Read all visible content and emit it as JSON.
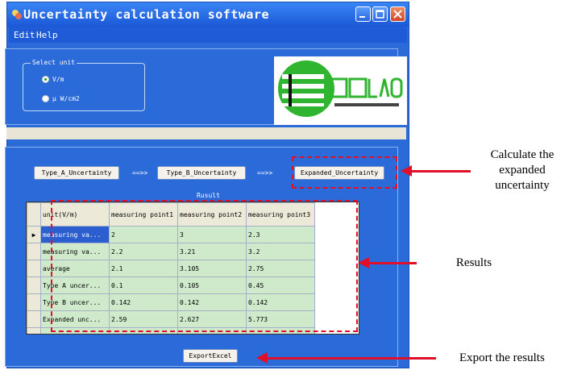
{
  "window": {
    "title": "Uncertainty calculation software",
    "controls": {
      "minimize": "minimize-icon",
      "maximize": "maximize-icon",
      "close": "close-icon"
    }
  },
  "menu": {
    "items": [
      "Edit",
      "Help"
    ]
  },
  "unit_group": {
    "legend": "Select unit",
    "options": [
      {
        "label": "V/m",
        "checked": true
      },
      {
        "label": "μ W/cm2",
        "checked": false
      }
    ]
  },
  "buttons": {
    "type_a": "Type_A_Uncertainty",
    "type_b": "Type_B_Uncertainty",
    "expanded": "Expanded_Uncertainty",
    "export": "ExportExcel"
  },
  "flow_arrow": "==>>",
  "result_label": "Rusult",
  "grid": {
    "columns": [
      "unit(V/m)",
      "measuring point1",
      "measuring point2",
      "measuring point3"
    ],
    "rows": [
      [
        "measuring va...",
        "2",
        "3",
        "2.3"
      ],
      [
        "measuring va...",
        "2.2",
        "3.21",
        "3.2"
      ],
      [
        "average",
        "2.1",
        "3.105",
        "2.75"
      ],
      [
        "Type A uncer...",
        "0.1",
        "0.105",
        "0.45"
      ],
      [
        "Type B uncer...",
        "0.142",
        "0.142",
        "0.142"
      ],
      [
        "Expanded unc...",
        "2.59",
        "2.627",
        "5.773"
      ]
    ],
    "current_row_marker": "▶",
    "new_row_marker": "*"
  },
  "annotations": {
    "expanded": "Calculate the expanded uncertainty",
    "results": "Results",
    "export": "Export the results"
  },
  "colors": {
    "window_blue": "#2b6ad9",
    "annotation_red": "#e0102b",
    "cell_green": "#cfe9cb"
  }
}
